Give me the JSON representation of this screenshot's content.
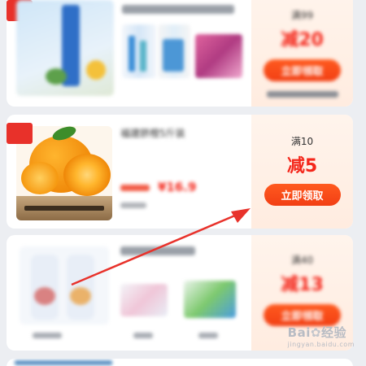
{
  "coupons": [
    {
      "threshold": "满99",
      "discount": "减20",
      "button": "立即领取"
    },
    {
      "threshold": "满10",
      "discount": "减5",
      "button": "立即领取",
      "title": "福建脐橙5斤装",
      "price": "¥16.9"
    },
    {
      "threshold": "满40",
      "discount": "减13",
      "button": "立即领取"
    }
  ],
  "watermark": {
    "brand": "Bai",
    "suffix": "经验",
    "site": "jingyan.baidu.com"
  },
  "colors": {
    "accent": "#f4271b",
    "button": "#f23f14",
    "arrow": "#e8322b",
    "tag": "#e8312a"
  }
}
